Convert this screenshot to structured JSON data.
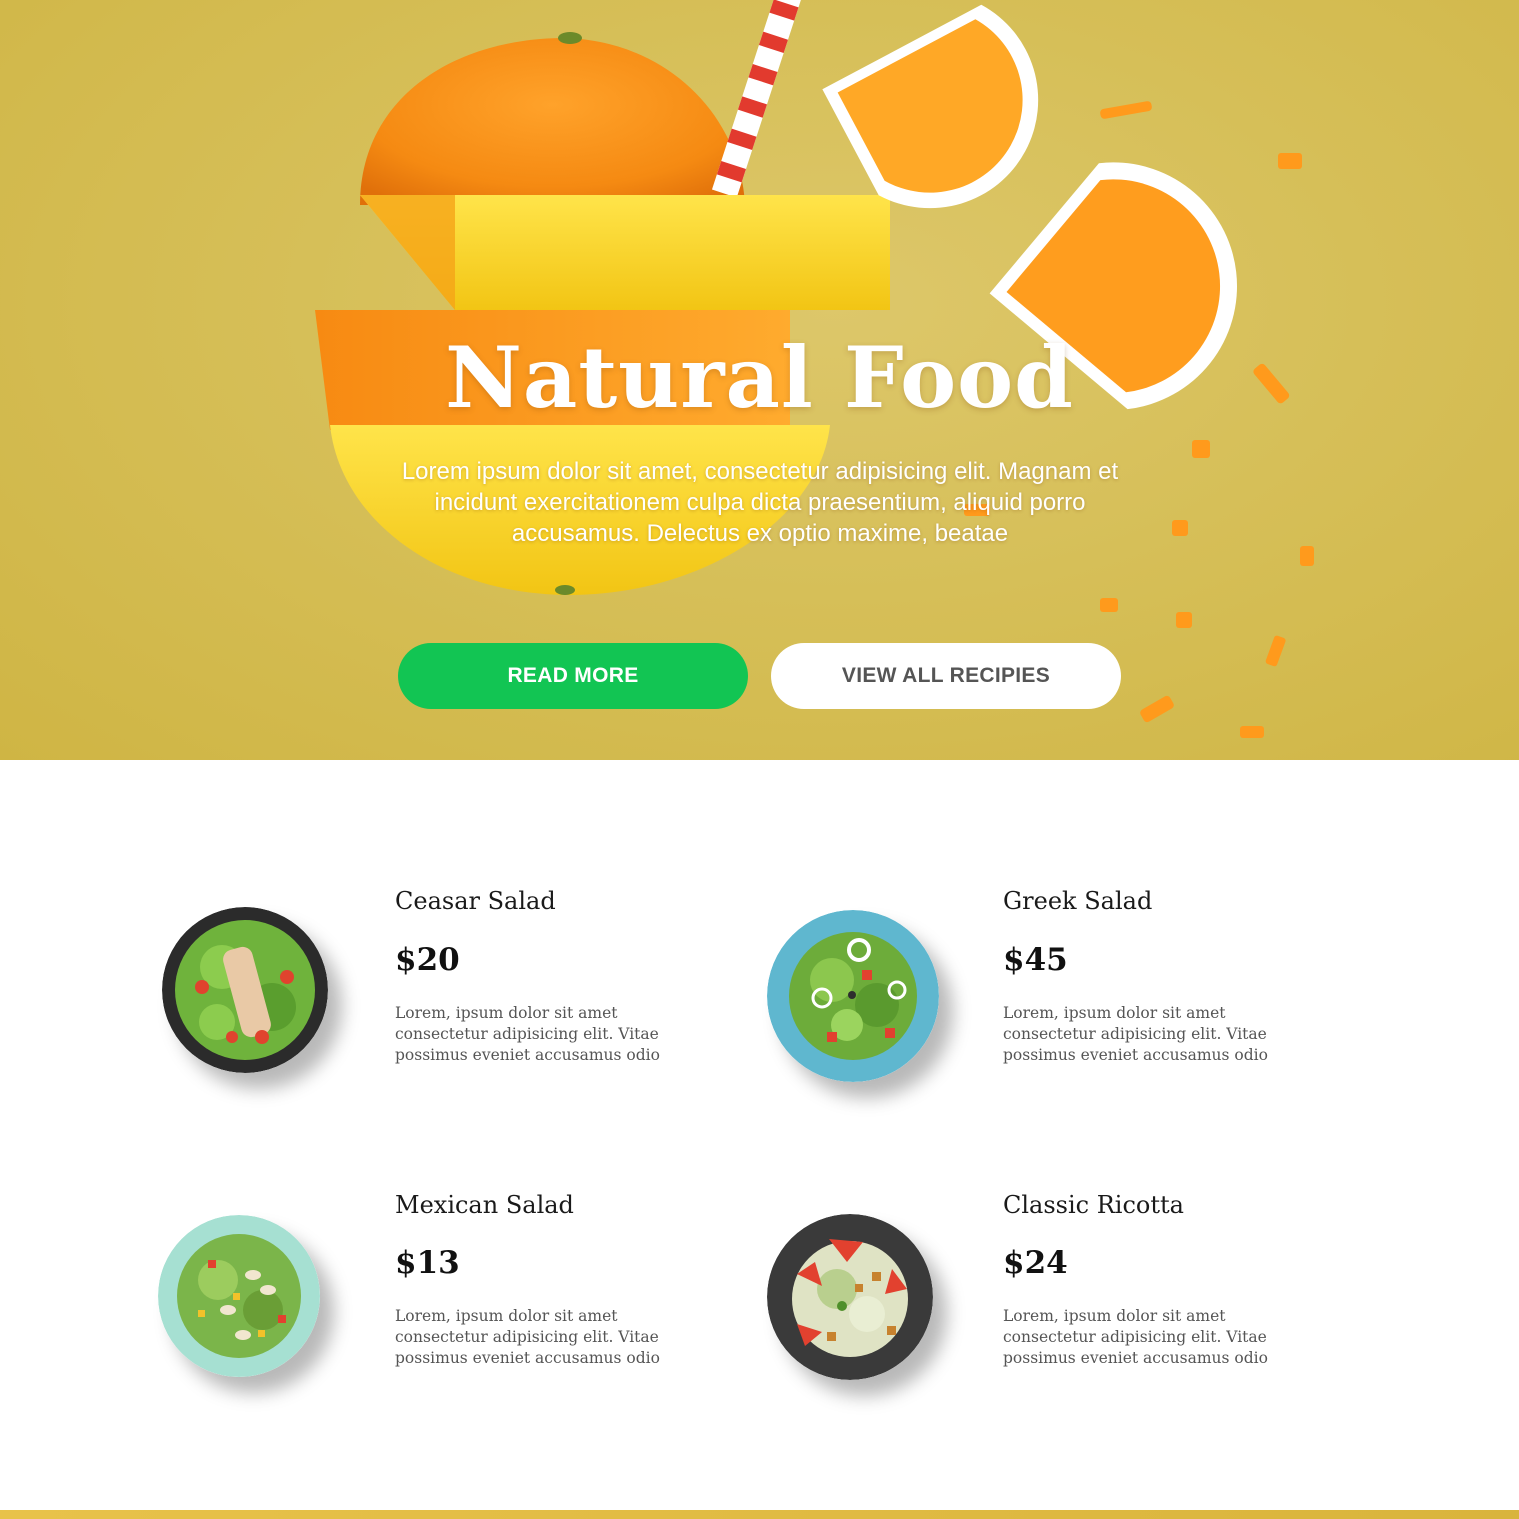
{
  "hero": {
    "title": "Natural Food",
    "description": "Lorem ipsum dolor sit amet, consectetur adipisicing elit. Magnam et incidunt exercitationem culpa dicta praesentium, aliquid porro accusamus. Delectus ex optio maxime, beatae",
    "primary_button": "READ MORE",
    "secondary_button": "VIEW ALL RECIPIES",
    "colors": {
      "background": "#d6bf58",
      "primary_button": "#12c553",
      "secondary_button": "#ffffff"
    }
  },
  "menu": {
    "items": [
      {
        "name": "Ceasar Salad",
        "price": "$20",
        "description": "Lorem, ipsum dolor sit amet consectetur adipisicing elit. Vitae possimus eveniet accusamus odio",
        "plate": "dark"
      },
      {
        "name": "Greek Salad",
        "price": "$45",
        "description": "Lorem, ipsum dolor sit amet consectetur adipisicing elit. Vitae possimus eveniet accusamus odio",
        "plate": "blue"
      },
      {
        "name": "Mexican Salad",
        "price": "$13",
        "description": "Lorem, ipsum dolor sit amet consectetur adipisicing elit. Vitae possimus eveniet accusamus odio",
        "plate": "mint"
      },
      {
        "name": "Classic Ricotta",
        "price": "$24",
        "description": "Lorem, ipsum dolor sit amet consectetur adipisicing elit. Vitae possimus eveniet accusamus odio",
        "plate": "dark"
      }
    ]
  }
}
